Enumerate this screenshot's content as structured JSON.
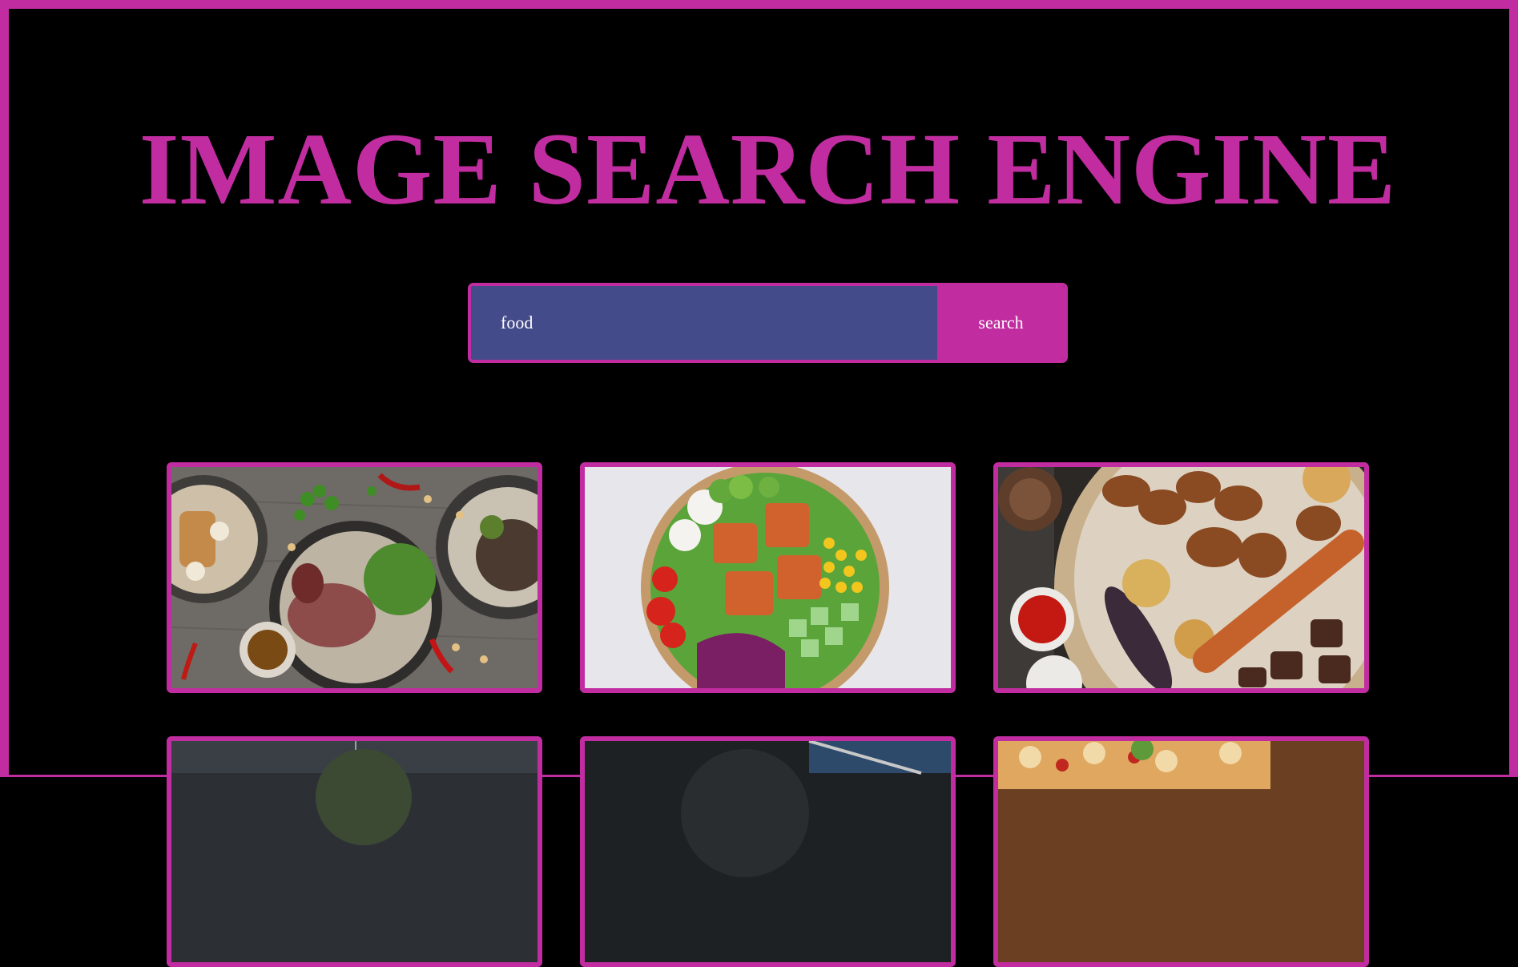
{
  "header": {
    "title": "IMAGE SEARCH ENGINE"
  },
  "search": {
    "value": "food",
    "placeholder": "",
    "button_label": "search"
  },
  "theme": {
    "accent": "#c12da0",
    "input_bg": "#444b8a",
    "page_bg": "#000000"
  },
  "results": [
    {
      "subject": "plated meals with steak, salad and dips on grey wood"
    },
    {
      "subject": "salad bowl with tofu, corn, egg, cucumber and red cabbage"
    },
    {
      "subject": "grilled kebab skewers, chicken wings, potatoes and sauces"
    },
    {
      "subject": "dark background food photo"
    },
    {
      "subject": "dark plate with cutlery"
    },
    {
      "subject": "pizza on wooden board"
    }
  ]
}
